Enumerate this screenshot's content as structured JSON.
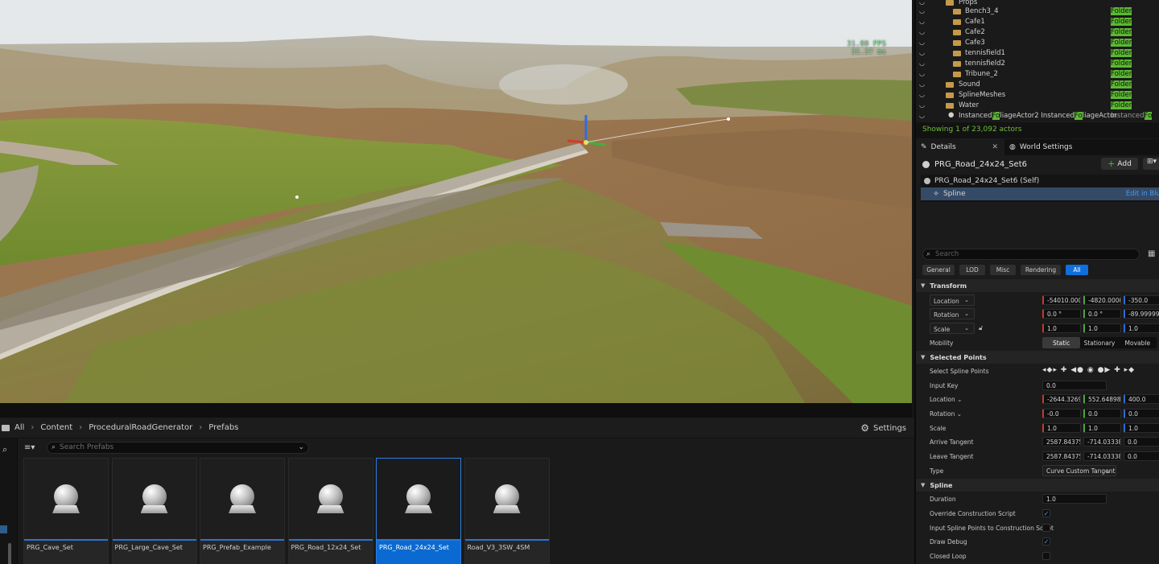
{
  "viewport": {
    "fps": "31.88 FPS",
    "ms": "31.37 ms"
  },
  "content_browser": {
    "breadcrumb": [
      "All",
      "Content",
      "ProceduralRoadGenerator",
      "Prefabs"
    ],
    "settings_label": "Settings",
    "search_placeholder": "Search Prefabs",
    "assets": [
      {
        "name": "PRG_Cave_Set",
        "selected": false
      },
      {
        "name": "PRG_Large_Cave_Set",
        "selected": false
      },
      {
        "name": "PRG_Prefab_Example",
        "selected": false
      },
      {
        "name": "PRG_Road_12x24_Set",
        "selected": false
      },
      {
        "name": "PRG_Road_24x24_Set",
        "selected": true
      },
      {
        "name": "Road_V3_3SW_4SM",
        "selected": false
      }
    ]
  },
  "outliner": {
    "rows": [
      {
        "label": "Props",
        "type": "",
        "indent": 2
      },
      {
        "label": "Bench3_4",
        "type": "Folder",
        "indent": 3
      },
      {
        "label": "Cafe1",
        "type": "Folder",
        "indent": 3
      },
      {
        "label": "Cafe2",
        "type": "Folder",
        "indent": 3
      },
      {
        "label": "Cafe3",
        "type": "Folder",
        "indent": 3
      },
      {
        "label": "tennisfield1",
        "type": "Folder",
        "indent": 3
      },
      {
        "label": "tennisfield2",
        "type": "Folder",
        "indent": 3
      },
      {
        "label": "Tribune_2",
        "type": "Folder",
        "indent": 3
      },
      {
        "label": "Sound",
        "type": "Folder",
        "indent": 2
      },
      {
        "label": "SplineMeshes",
        "type": "Folder",
        "indent": 2
      },
      {
        "label": "Water",
        "type": "Folder",
        "indent": 2
      }
    ],
    "foliage_row": {
      "label_a": "Instanced",
      "label_hl": "Fo",
      "label_b": "liageActor2 Instanced",
      "label_hl2": "Fo",
      "label_c": "liageActor",
      "type_a": "Instanced",
      "type_hl": "Fo"
    },
    "status": "Showing 1 of 23,092 actors"
  },
  "tabs": {
    "details": "Details",
    "world_settings": "World Settings"
  },
  "details": {
    "actor_name": "PRG_Road_24x24_Set6",
    "add_label": "Add",
    "components": [
      {
        "label": "PRG_Road_24x24_Set6 (Self)",
        "selected": false
      },
      {
        "label": "Spline",
        "selected": true,
        "action": "Edit in Blu"
      }
    ],
    "search_placeholder": "Search",
    "filters": [
      "General",
      "LOD",
      "Misc",
      "Rendering",
      "All"
    ],
    "active_filter": "All",
    "transform": {
      "title": "Transform",
      "location_label": "Location",
      "location": [
        "-54010.0000",
        "-4820.00000",
        "-350.0"
      ],
      "rotation_label": "Rotation",
      "rotation": [
        "0.0 °",
        "0.0 °",
        "-89.999999"
      ],
      "scale_label": "Scale",
      "scale": [
        "1.0",
        "1.0",
        "1.0"
      ],
      "mobility_label": "Mobility",
      "mobility_options": [
        "Static",
        "Stationary",
        "Movable"
      ],
      "mobility_selected": "Static"
    },
    "selected_points": {
      "title": "Selected Points",
      "select_label": "Select Spline Points",
      "select_icons": "◂◆▸ ✚ ◀● ◉ ●▶ ✚ ▸◆",
      "input_key_label": "Input Key",
      "input_key": "0.0",
      "location_label": "Location",
      "location": [
        "-2644.32690",
        "552.648987",
        "400.0"
      ],
      "rotation_label": "Rotation",
      "rotation": [
        "-0.0",
        "0.0",
        "0.0"
      ],
      "scale_label": "Scale",
      "scale": [
        "1.0",
        "1.0",
        "1.0"
      ],
      "arrive_label": "Arrive Tangent",
      "arrive": [
        "2587.84375",
        "-714.033386",
        "0.0"
      ],
      "leave_label": "Leave Tangent",
      "leave": [
        "2587.84375",
        "-714.033386",
        "0.0"
      ],
      "type_label": "Type",
      "type_value": "Curve Custom Tangent"
    },
    "spline": {
      "title": "Spline",
      "duration_label": "Duration",
      "duration": "1.0",
      "override_label": "Override Construction Script",
      "override_checked": true,
      "input_points_label": "Input Spline Points to Construction Script",
      "input_points_checked": false,
      "draw_debug_label": "Draw Debug",
      "draw_debug_checked": true,
      "closed_loop_label": "Closed Loop",
      "closed_loop_checked": false
    }
  }
}
